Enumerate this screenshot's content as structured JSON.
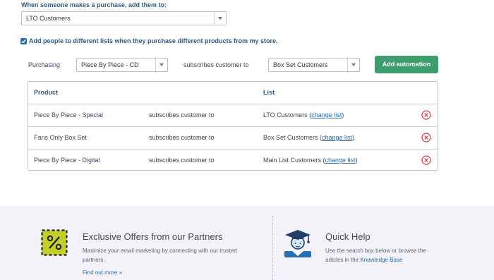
{
  "purchase": {
    "label": "When someone makes a purchase, add them to:",
    "list_value": "LTO Customers"
  },
  "options": {
    "checkbox_checked": true,
    "checkbox_label": "Add people to different lists when they purchase different products from my store."
  },
  "automation": {
    "purchasing_label": "Purchasing",
    "product_value": "Piece By Piece - CD",
    "subscribes_label": "subscribes customer to",
    "list_value": "Box Set Customers",
    "add_button": "Add automation"
  },
  "table": {
    "headers": {
      "product": "Product",
      "list": "List"
    },
    "rows": [
      {
        "product": "Piece By Piece - Special",
        "middle": "subscribes customer to",
        "list": "LTO Customers",
        "open": " (",
        "change": "change list",
        "close": ")"
      },
      {
        "product": "Fans Only Box Set",
        "middle": "subscribes customer to",
        "list": "Box Set Customers",
        "open": " (",
        "change": "change list",
        "close": ")"
      },
      {
        "product": "Piece By Piece - Digital",
        "middle": "subscribes customer to",
        "list": "Main List Customers",
        "open": " (",
        "change": "change list",
        "close": ")"
      }
    ]
  },
  "footer": {
    "offers": {
      "icon": "percent-tag-icon",
      "title": "Exclusive Offers from our Partners",
      "desc_line1": "Maximize your email marketing by connecting with our trusted",
      "desc_line2": "partners.",
      "link": "Find out more »"
    },
    "help": {
      "icon": "graduate-icon",
      "title": "Quick Help",
      "desc_line1": "Use the search box below or browse the",
      "desc_prefix": "articles in the ",
      "kb_link": "Knowledge Base"
    }
  },
  "colors": {
    "primary": "#2a6fb4",
    "accent_green": "#3c9e6d",
    "delete_red": "#d9363e",
    "footer_bg": "#f3f2f8"
  }
}
